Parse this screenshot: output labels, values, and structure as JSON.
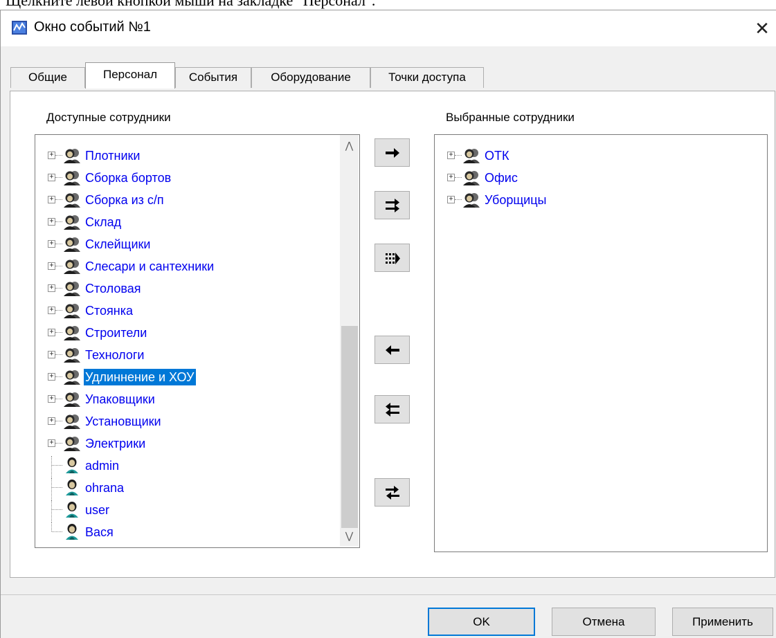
{
  "document": {
    "instruction": "Щелкните левой кнопкой мыши на закладке \"Персонал\"."
  },
  "window": {
    "title": "Окно событий №1",
    "close_glyph": "✕"
  },
  "tabs": [
    {
      "label": "Общие",
      "active": false
    },
    {
      "label": "Персонал",
      "active": true
    },
    {
      "label": "События",
      "active": false
    },
    {
      "label": "Оборудование",
      "active": false
    },
    {
      "label": "Точки доступа",
      "active": false
    }
  ],
  "available": {
    "label": "Доступные сотрудники",
    "items": [
      {
        "label": "Плотники",
        "type": "group"
      },
      {
        "label": "Сборка бортов",
        "type": "group"
      },
      {
        "label": "Сборка из с/п",
        "type": "group"
      },
      {
        "label": "Склад",
        "type": "group"
      },
      {
        "label": "Склейщики",
        "type": "group"
      },
      {
        "label": "Слесари и сантехники",
        "type": "group"
      },
      {
        "label": "Столовая",
        "type": "group"
      },
      {
        "label": "Стоянка",
        "type": "group"
      },
      {
        "label": "Строители",
        "type": "group"
      },
      {
        "label": "Технологи",
        "type": "group"
      },
      {
        "label": "Удлиннение и ХОУ",
        "type": "group",
        "selected": true
      },
      {
        "label": "Упаковщики",
        "type": "group"
      },
      {
        "label": "Установщики",
        "type": "group"
      },
      {
        "label": "Электрики",
        "type": "group"
      },
      {
        "label": "admin",
        "type": "user"
      },
      {
        "label": "ohrana",
        "type": "user"
      },
      {
        "label": "user",
        "type": "user"
      },
      {
        "label": "Вася",
        "type": "user"
      }
    ],
    "scroll_up_glyph": "⋀",
    "scroll_down_glyph": "⋁"
  },
  "selected": {
    "label": "Выбранные сотрудники",
    "items": [
      {
        "label": "ОТК",
        "type": "group"
      },
      {
        "label": "Офис",
        "type": "group"
      },
      {
        "label": "Уборщицы",
        "type": "group"
      }
    ]
  },
  "transfer_buttons": [
    {
      "name": "add-one-button",
      "icon": "arrow-right-icon"
    },
    {
      "name": "add-group-button",
      "icon": "double-arrow-right-icon"
    },
    {
      "name": "add-all-button",
      "icon": "dotted-arrow-right-icon"
    },
    {
      "name": "remove-one-button",
      "icon": "arrow-left-icon"
    },
    {
      "name": "remove-group-button",
      "icon": "double-arrow-left-icon"
    },
    {
      "name": "swap-button",
      "icon": "swap-arrows-icon"
    }
  ],
  "buttons": {
    "ok": "OK",
    "cancel": "Отмена",
    "apply": "Применить"
  },
  "colors": {
    "link_text": "#0000ee",
    "selection": "#0078d7",
    "default_button_border": "#0078d7"
  }
}
